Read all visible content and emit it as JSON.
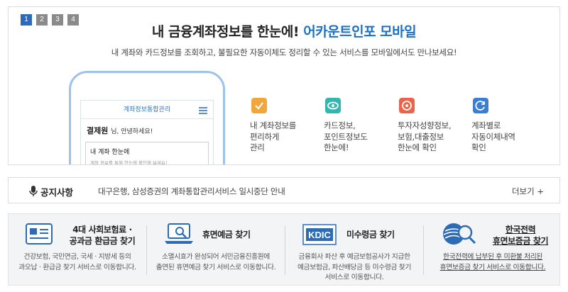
{
  "banner": {
    "pages": [
      "1",
      "2",
      "3",
      "4"
    ],
    "active_page": "1",
    "headline_main": "내 금융계좌정보를 한눈에!",
    "headline_accent": "어카운트인포 모바일",
    "subline": "내 계좌와 카드정보를 조회하고, 불필요한 자동이체도 정리할 수 있는 서비스를 모바일에서도 만나보세요!",
    "phone": {
      "title": "계좌정보통합관리",
      "user_name": "결제원",
      "greeting": "님, 안녕하세요!",
      "card_title": "내 계좌 한눈에",
      "card_desc": "계좌 정보를 통해 한눈에 확인해 보세요!"
    },
    "features": [
      {
        "icon": "check-icon",
        "color": "#f0a63a",
        "text": "내 계좌정보를\n편리하게\n관리"
      },
      {
        "icon": "eye-icon",
        "color": "#33b5b0",
        "text": "카드정보,\n포인트정보도\n한눈에!"
      },
      {
        "icon": "target-icon",
        "color": "#e8654a",
        "text": "투자자성향정보,\n보험,대출정보\n한눈에 확인"
      },
      {
        "icon": "refresh-icon",
        "color": "#3b7fd4",
        "text": "계좌별로\n자동이체내역\n확인"
      }
    ]
  },
  "notice": {
    "title": "공지사항",
    "message": "대구은행, 삼성증권의 계좌통합관리서비스 일시중단 안내",
    "more": "더보기 +"
  },
  "services": [
    {
      "icon": "insurance-card-icon",
      "title": "4대 사회보험료 ·\n공과금 환급금 찾기",
      "desc": "건강보험, 국민연금, 국세 · 지방세 등의\n과오납 · 환급금 찾기 서비스로 이동합니다."
    },
    {
      "icon": "laptop-search-icon",
      "title": "휴면예금 찾기",
      "desc": "소멸시효가 완성되어 서민금융진흥원에\n출연된 휴면예금 찾기 서비스로 이동합니다."
    },
    {
      "icon": "kdic-logo",
      "logo_text": "KDIC",
      "title": "미수령금 찾기",
      "desc": "금융회사 파산 후 예금보험공사가 지급한\n예금보험금, 파산배당금 등 미수령금 찾기\n서비스로 이동합니다."
    },
    {
      "icon": "kepco-logo",
      "title": "한국전력\n휴면보증금 찾기",
      "desc": "한국전력에 납부된 후 미환불 처리된\n휴면보증금 찾기 서비스로 이동합니다."
    }
  ]
}
